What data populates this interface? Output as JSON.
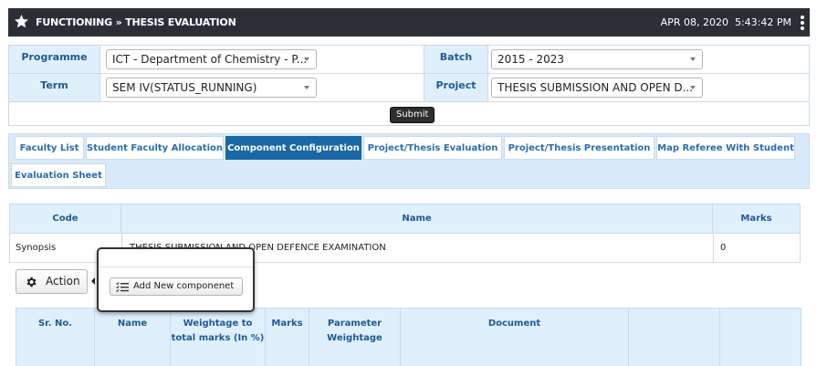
{
  "header": {
    "title": "FUNCTIONING » THESIS EVALUATION",
    "date": "APR 08, 2020",
    "time": "5:43:42 PM"
  },
  "filters": {
    "programme_label": "Programme",
    "programme_value": "ICT - Department of Chemistry - P...",
    "batch_label": "Batch",
    "batch_value": "2015 - 2023",
    "term_label": "Term",
    "term_value": "SEM IV(STATUS_RUNNING)",
    "project_label": "Project",
    "project_value": "THESIS SUBMISSION AND OPEN D...",
    "submit_label": "Submit"
  },
  "tabs": [
    {
      "label": "Faculty List"
    },
    {
      "label": "Student Faculty Allocation"
    },
    {
      "label": "Component Configuration"
    },
    {
      "label": "Project/Thesis Evaluation"
    },
    {
      "label": "Project/Thesis Presentation"
    },
    {
      "label": "Map Referee With Student"
    },
    {
      "label": "Evaluation Sheet"
    }
  ],
  "active_tab": "Component Configuration",
  "component_table": {
    "headers": [
      "Code",
      "Name",
      "Marks"
    ],
    "rows": [
      {
        "code": "Synopsis",
        "name": "THESIS SUBMISSION AND OPEN DEFENCE EXAMINATION",
        "marks": "0"
      }
    ]
  },
  "action": {
    "label": "Action",
    "menu_item": "Add New componenet"
  },
  "parameter_table": {
    "headers": [
      "Sr. No.",
      "Name",
      "Weightage to total marks (In %)",
      "Marks",
      "Parameter Weightage",
      "Document",
      "",
      ""
    ]
  },
  "colors": {
    "topbar": "#2b2f35",
    "header_bg": "#dfeffc",
    "label_text": "#1f5a94",
    "active_tab": "#1a67a6",
    "tab_text": "#2a6dad"
  }
}
